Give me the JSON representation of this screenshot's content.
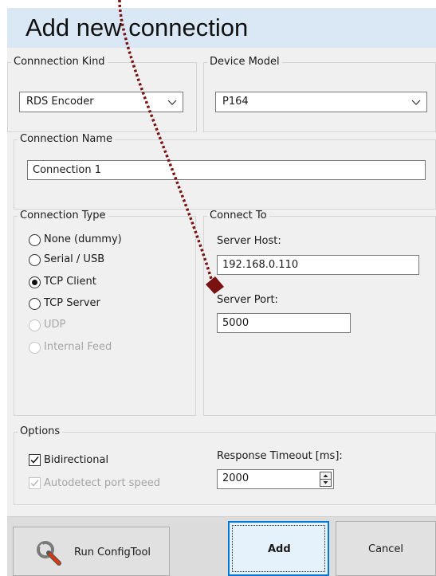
{
  "dialog": {
    "title": "Add new connection"
  },
  "connection_kind": {
    "label": "Connnection Kind",
    "selected": "RDS Encoder"
  },
  "device_model": {
    "label": "Device Model",
    "selected": "P164"
  },
  "connection_name": {
    "label": "Connection Name",
    "value": "Connection 1"
  },
  "connection_type": {
    "label": "Connection Type",
    "options": [
      {
        "label": "None (dummy)",
        "checked": false,
        "enabled": true
      },
      {
        "label": "Serial / USB",
        "checked": false,
        "enabled": true
      },
      {
        "label": "TCP Client",
        "checked": true,
        "enabled": true
      },
      {
        "label": "TCP Server",
        "checked": false,
        "enabled": true
      },
      {
        "label": "UDP",
        "checked": false,
        "enabled": false
      },
      {
        "label": "Internal Feed",
        "checked": false,
        "enabled": false
      }
    ]
  },
  "connect_to": {
    "label": "Connect To",
    "host_label": "Server Host:",
    "host_value": "192.168.0.110",
    "port_label": "Server Port:",
    "port_value": "5000"
  },
  "options": {
    "label": "Options",
    "bidirectional_label": "Bidirectional",
    "bidirectional_checked": true,
    "autodetect_label": "Autodetect port speed",
    "autodetect_checked": true,
    "autodetect_enabled": false,
    "timeout_label": "Response Timeout [ms]:",
    "timeout_value": "2000"
  },
  "footer": {
    "configtool_label": "Run ConfigTool",
    "add_label": "Add",
    "cancel_label": "Cancel"
  },
  "colors": {
    "title_bar": "#dae8f5",
    "dialog_bg": "#f0f0f0",
    "primary_border": "#0078d7",
    "annotation": "#7a1212"
  },
  "icons": {
    "configtool": "wrench-icon",
    "combo_arrow": "chevron-down-icon",
    "annotation": "arrow-annotation-icon"
  }
}
